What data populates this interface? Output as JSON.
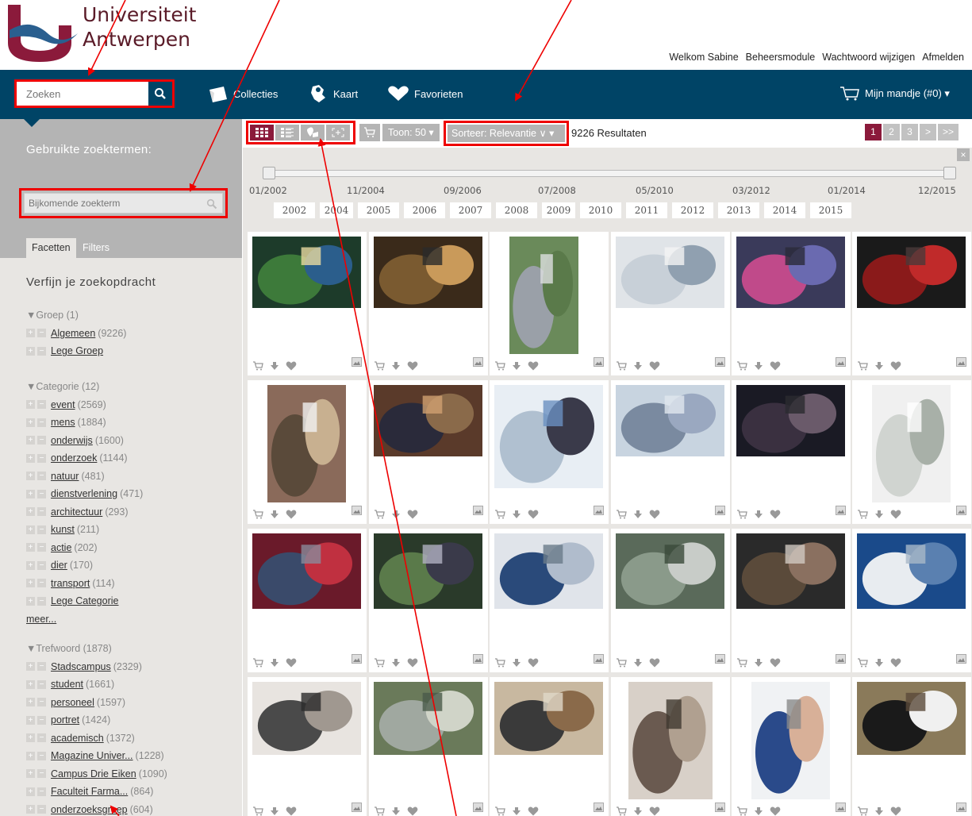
{
  "logo": {
    "line1": "Universiteit",
    "line2": "Antwerpen"
  },
  "toplinks": [
    "Welkom Sabine",
    "Beheersmodule",
    "Wachtwoord wijzigen",
    "Afmelden"
  ],
  "search": {
    "placeholder": "Zoeken"
  },
  "nav": {
    "collections": "Collecties",
    "map": "Kaart",
    "favorites": "Favorieten",
    "cart": "Mijn mandje (#0) ▾"
  },
  "sidebar": {
    "used_terms_title": "Gebruikte zoektermen:",
    "extra_term_placeholder": "Bijkomende zoekterm",
    "tab_facets": "Facetten",
    "tab_filters": "Filters",
    "refine_title": "Verfijn je zoekopdracht",
    "groups": [
      {
        "head": "▼Groep (1)",
        "items": [
          {
            "label": "Algemeen",
            "count": "(9226)"
          },
          {
            "label": "Lege Groep",
            "count": ""
          }
        ]
      },
      {
        "head": "▼Categorie (12)",
        "more": "meer...",
        "items": [
          {
            "label": "event",
            "count": "(2569)"
          },
          {
            "label": "mens",
            "count": "(1884)"
          },
          {
            "label": "onderwijs",
            "count": "(1600)"
          },
          {
            "label": "onderzoek",
            "count": "(1144)"
          },
          {
            "label": "natuur",
            "count": "(481)"
          },
          {
            "label": "dienstverlening",
            "count": "(471)"
          },
          {
            "label": "architectuur",
            "count": "(293)"
          },
          {
            "label": "kunst",
            "count": "(211)"
          },
          {
            "label": "actie",
            "count": "(202)"
          },
          {
            "label": "dier",
            "count": "(170)"
          },
          {
            "label": "transport",
            "count": "(114)"
          },
          {
            "label": "Lege Categorie",
            "count": ""
          }
        ]
      },
      {
        "head": "▼Trefwoord (1878)",
        "items": [
          {
            "label": "Stadscampus",
            "count": "(2329)"
          },
          {
            "label": "student",
            "count": "(1661)"
          },
          {
            "label": "personeel",
            "count": "(1597)"
          },
          {
            "label": "portret",
            "count": "(1424)"
          },
          {
            "label": "academisch",
            "count": "(1372)"
          },
          {
            "label": "Magazine Univer...",
            "count": "(1228)"
          },
          {
            "label": "Campus Drie Eiken",
            "count": "(1090)"
          },
          {
            "label": "Faculteit Farma...",
            "count": "(864)"
          },
          {
            "label": "onderzoeksgroep",
            "count": "(604)"
          }
        ]
      }
    ]
  },
  "toolbar": {
    "toon": "Toon: 50 ▾",
    "sort": "Sorteer: Relevantie ∨ ▾",
    "results": "9226 Resultaten",
    "pages": [
      "1",
      "2",
      "3",
      ">",
      ">>"
    ]
  },
  "timeline": {
    "dates": [
      "01/2002",
      "11/2004",
      "09/2006",
      "07/2008",
      "05/2010",
      "03/2012",
      "01/2014",
      "12/2015"
    ],
    "years": [
      "2002",
      "2004",
      "2005",
      "2006",
      "2007",
      "2008",
      "2009",
      "2010",
      "2011",
      "2012",
      "2013",
      "2014",
      "2015"
    ],
    "close": "×"
  },
  "colors": {
    "navy": "#004466",
    "accent": "#8b1a3b",
    "highlight_red": "#e00000",
    "sidebar_grey": "#b4b4b4",
    "bg_light": "#e8e6e3"
  }
}
